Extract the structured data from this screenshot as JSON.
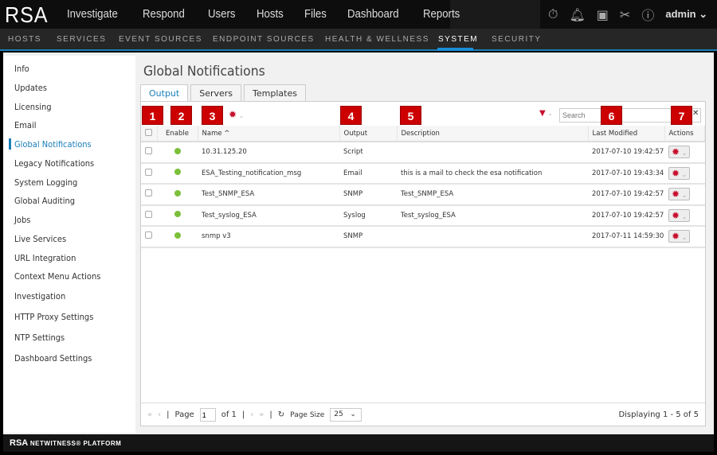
{
  "header": {
    "logo": "RSA",
    "nav": [
      "Investigate",
      "Respond",
      "Users",
      "Hosts",
      "Files",
      "Dashboard",
      "Reports"
    ],
    "user": "admin"
  },
  "subnav": {
    "items": [
      "HOSTS",
      "SERVICES",
      "EVENT SOURCES",
      "ENDPOINT SOURCES",
      "HEALTH & WELLNESS",
      "SYSTEM",
      "SECURITY"
    ],
    "active": "SYSTEM"
  },
  "sidebar": {
    "items": [
      "Info",
      "Updates",
      "Licensing",
      "Email",
      "Global Notifications",
      "Legacy Notifications",
      "System Logging",
      "Global Auditing",
      "Jobs",
      "Live Services",
      "URL Integration",
      "Context Menu Actions",
      "Investigation",
      "HTTP Proxy Settings",
      "NTP Settings",
      "Dashboard Settings"
    ],
    "active": "Global Notifications"
  },
  "page": {
    "title": "Global Notifications",
    "tabs": [
      "Output",
      "Servers",
      "Templates"
    ],
    "active_tab": "Output"
  },
  "toolbar": {
    "search_placeholder": "Search",
    "callouts": [
      "1",
      "2",
      "3",
      "4",
      "5",
      "6",
      "7"
    ]
  },
  "table": {
    "columns": [
      "Enable",
      "Name ^",
      "Output",
      "Description",
      "Last Modified",
      "Actions"
    ],
    "rows": [
      {
        "name": "10.31.125.20",
        "output": "Script",
        "description": "",
        "modified": "2017-07-10 19:42:57",
        "enabled": true
      },
      {
        "name": "ESA_Testing_notification_msg",
        "output": "Email",
        "description": "this is a mail to check the esa notification",
        "modified": "2017-07-10 19:43:34",
        "enabled": true
      },
      {
        "name": "Test_SNMP_ESA",
        "output": "SNMP",
        "description": "Test_SNMP_ESA",
        "modified": "2017-07-10 19:42:57",
        "enabled": true
      },
      {
        "name": "Test_syslog_ESA",
        "output": "Syslog",
        "description": "Test_syslog_ESA",
        "modified": "2017-07-10 19:42:57",
        "enabled": true
      },
      {
        "name": "snmp v3",
        "output": "SNMP",
        "description": "",
        "modified": "2017-07-11 14:59:30",
        "enabled": true
      }
    ]
  },
  "pager": {
    "page_label": "Page",
    "page": "1",
    "of": "of 1",
    "page_size_label": "Page Size",
    "page_size": "25",
    "displaying": "Displaying 1 - 5 of 5"
  },
  "footer": {
    "brand": "RSA",
    "product": "NETWITNESS® PLATFORM"
  },
  "colors": {
    "accent": "#1a7fb8",
    "callout": "#cc0000",
    "enabled": "#7cbf3a"
  }
}
